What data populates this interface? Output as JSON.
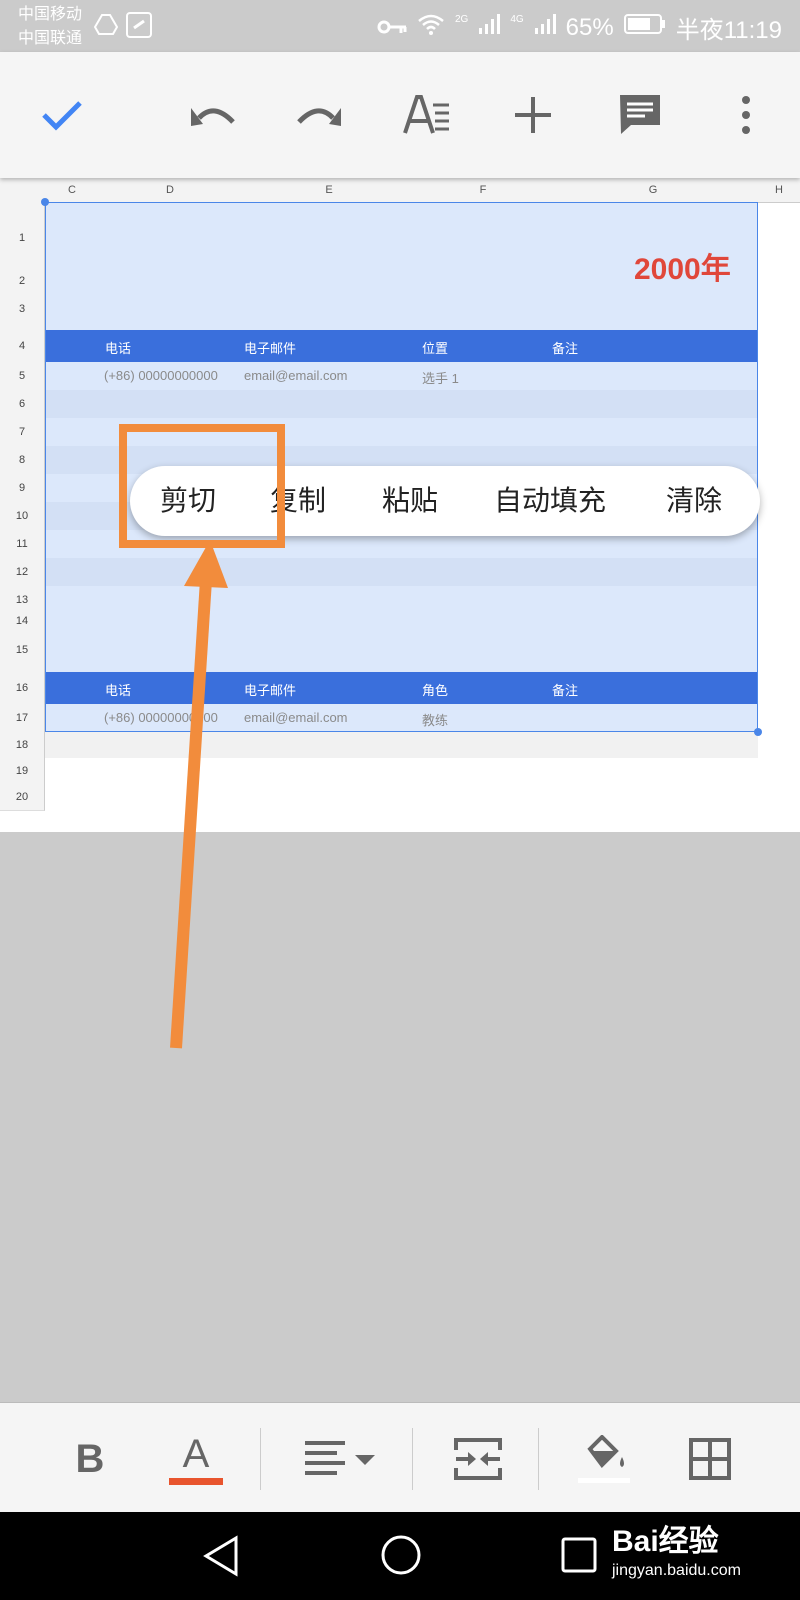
{
  "status_bar": {
    "carrier_1": "中国移动",
    "carrier_2": "中国联通",
    "signal_2g": "2G",
    "signal_4g": "4G",
    "battery": "65%",
    "time": "半夜11:19"
  },
  "toolbar": {
    "icons": [
      "check-icon",
      "undo-icon",
      "redo-icon",
      "text-format-icon",
      "add-icon",
      "comment-icon",
      "more-vert-icon"
    ],
    "accent": "#4285f4"
  },
  "sheet": {
    "columns": [
      "C",
      "D",
      "E",
      "F",
      "G",
      "H"
    ],
    "rows": [
      "1",
      "2",
      "3",
      "4",
      "5",
      "6",
      "7",
      "8",
      "9",
      "10",
      "11",
      "12",
      "13",
      "14",
      "15",
      "16",
      "17",
      "18",
      "19",
      "20"
    ],
    "title": "2000年",
    "header_1": {
      "phone": "电话",
      "email": "电子邮件",
      "position": "位置",
      "note": "备注"
    },
    "record_1": {
      "phone": "(+86) 00000000000",
      "email": "email@email.com",
      "position": "选手 1"
    },
    "header_2": {
      "phone": "电话",
      "email": "电子邮件",
      "role": "角色",
      "note": "备注"
    },
    "record_2": {
      "phone": "(+86) 00000000000",
      "email": "email@email.com",
      "role": "教练"
    },
    "colors": {
      "selection": "#dce8fb",
      "header_band": "#3a6fdc",
      "title_red": "#e0473a"
    }
  },
  "context_menu": {
    "items": [
      "剪切",
      "复制",
      "粘贴",
      "自动填充",
      "清除"
    ]
  },
  "format_bar": {
    "bold_label": "B",
    "text_color_label": "A",
    "icons": [
      "bold-icon",
      "text-color-icon",
      "align-icon",
      "merge-cells-icon",
      "fill-color-icon",
      "borders-icon"
    ],
    "text_color_underline": "#e8542d"
  },
  "watermark": {
    "brand": "Bai经验",
    "url": "jingyan.baidu.com"
  },
  "annotation": {
    "highlight_color": "#f28c3c"
  }
}
